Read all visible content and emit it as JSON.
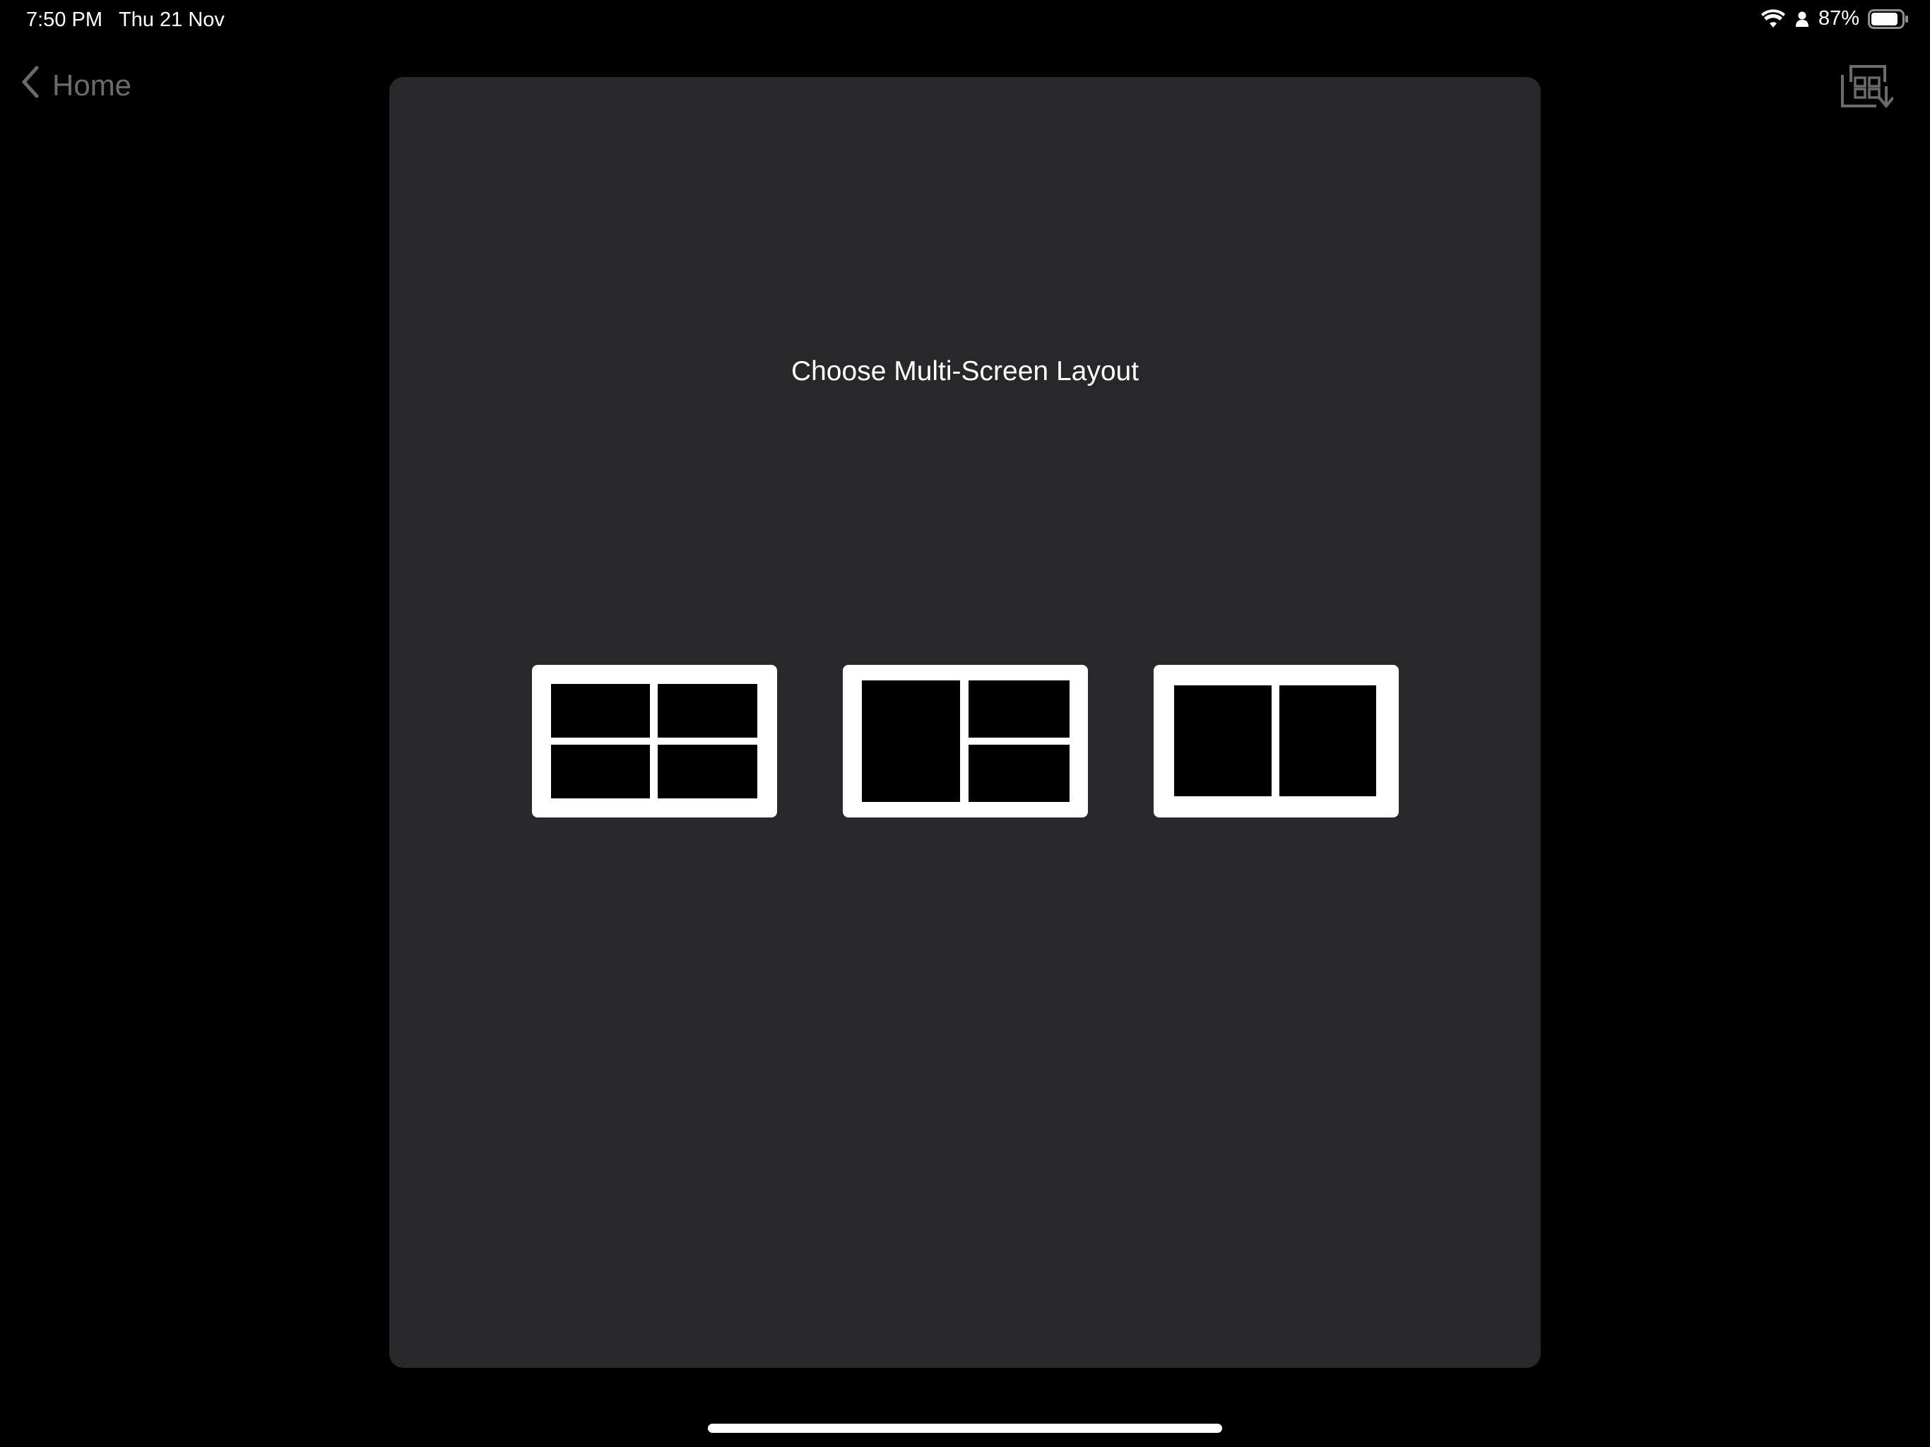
{
  "status_bar": {
    "time": "7:50 PM",
    "date": "Thu 21 Nov",
    "battery_percent": "87%",
    "battery_level": 0.87,
    "icons": [
      "wifi-icon",
      "person-icon",
      "battery-icon"
    ]
  },
  "nav": {
    "back_label": "Home",
    "back_icon": "chevron-left-icon",
    "action_icon": "layout-swap-icon"
  },
  "sheet": {
    "title": "Choose Multi-Screen Layout",
    "layouts": [
      {
        "id": "quad",
        "icon": "four-pane-layout-icon"
      },
      {
        "id": "one-plus-two",
        "icon": "one-plus-two-layout-icon"
      },
      {
        "id": "side-by-side",
        "icon": "two-pane-layout-icon"
      }
    ]
  },
  "colors": {
    "background": "#000000",
    "sheet": "#28282a",
    "text": "#ffffff",
    "dimmed": "#6b6b6e"
  }
}
